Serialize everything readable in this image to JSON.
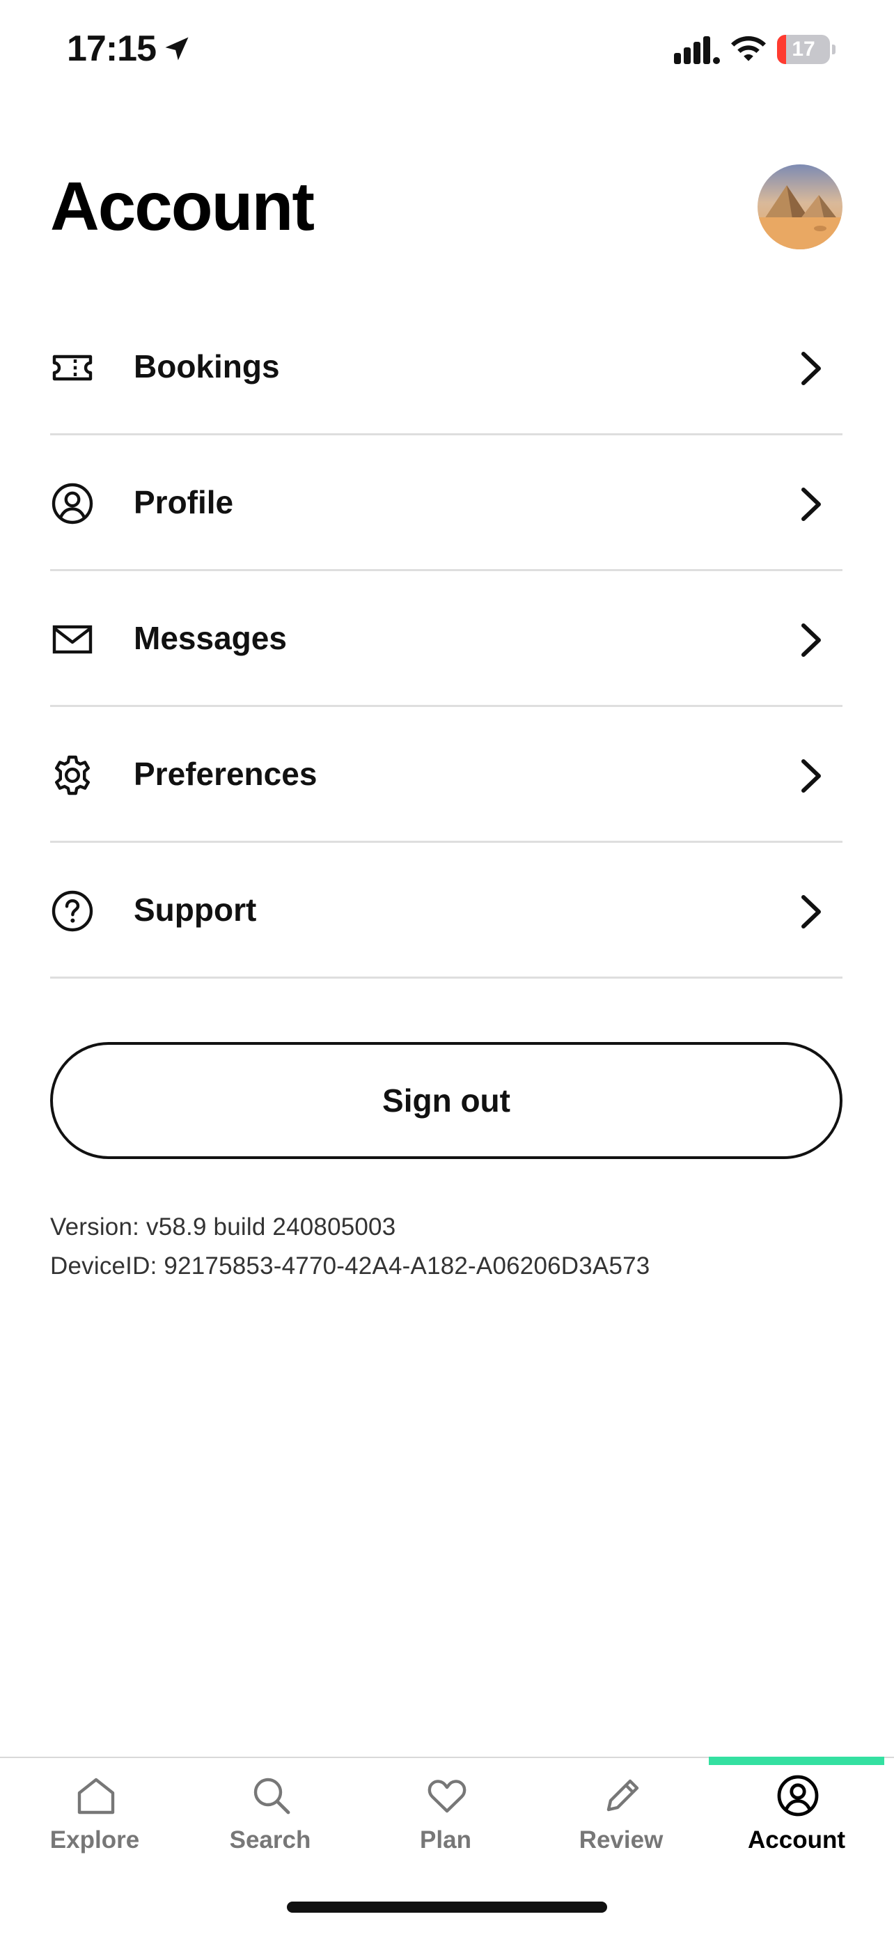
{
  "status_bar": {
    "time": "17:15",
    "battery_level": "17",
    "battery_fraction": 0.17,
    "battery_color": "#ff3b30",
    "icons": [
      "location-arrow-icon",
      "cellular-signal-icon",
      "wifi-icon",
      "battery-icon"
    ]
  },
  "header": {
    "title": "Account",
    "avatar_icon": "user-avatar-photo"
  },
  "menu": {
    "items": [
      {
        "label": "Bookings",
        "icon": "ticket-icon"
      },
      {
        "label": "Profile",
        "icon": "user-circle-icon"
      },
      {
        "label": "Messages",
        "icon": "envelope-icon"
      },
      {
        "label": "Preferences",
        "icon": "gear-icon"
      },
      {
        "label": "Support",
        "icon": "question-circle-icon"
      }
    ]
  },
  "sign_out_label": "Sign out",
  "app_info": {
    "version": "Version: v58.9 build 240805003",
    "device_id": "DeviceID: 92175853-4770-42A4-A182-A06206D3A573"
  },
  "tab_bar": {
    "accent_color": "#34e0a1",
    "active_tab": "Account",
    "tabs": [
      {
        "label": "Explore",
        "icon": "home-icon"
      },
      {
        "label": "Search",
        "icon": "search-icon"
      },
      {
        "label": "Plan",
        "icon": "heart-icon"
      },
      {
        "label": "Review",
        "icon": "pencil-icon"
      },
      {
        "label": "Account",
        "icon": "user-circle-icon"
      }
    ]
  }
}
